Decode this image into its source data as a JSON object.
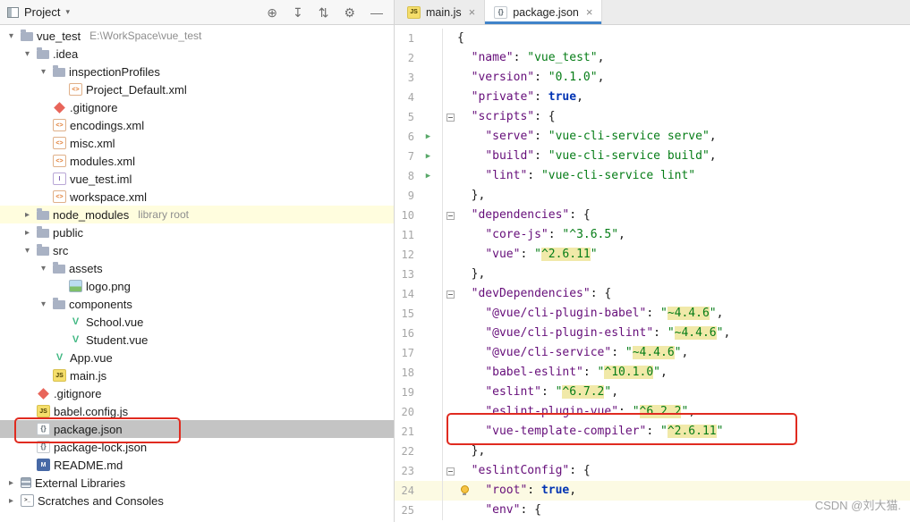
{
  "colors": {
    "accent_blue": "#4083C9",
    "selection_gray": "#C4C4C4",
    "row_yellow": "#FFFDDE",
    "caret_line": "#FCFAE3",
    "match_yellow": "#F1E9A9",
    "red_box": "#E02B20",
    "key_purple": "#660E7A",
    "string_green": "#067D17",
    "keyword_blue": "#0033B3",
    "run_green": "#59A869"
  },
  "toolbar": {
    "project_label": "Project",
    "dropdown_glyph": "▾",
    "icons": [
      {
        "name": "locate-file-icon",
        "glyph": "⊕"
      },
      {
        "name": "scroll-to-source-icon",
        "glyph": "↧"
      },
      {
        "name": "collapse-all-icon",
        "glyph": "⇅"
      },
      {
        "name": "settings-gear-icon",
        "glyph": "⚙"
      },
      {
        "name": "hide-panel-icon",
        "glyph": "—"
      }
    ]
  },
  "tabs": [
    {
      "label": "main.js",
      "icon": "js",
      "close_glyph": "×",
      "active": false
    },
    {
      "label": "package.json",
      "icon": "json",
      "close_glyph": "×",
      "active": true
    }
  ],
  "tree": [
    {
      "indent": 0,
      "chevron": "down",
      "icon": "folder",
      "label": "vue_test",
      "suffix": "E:\\WorkSpace\\vue_test"
    },
    {
      "indent": 1,
      "chevron": "down",
      "icon": "folder",
      "label": ".idea"
    },
    {
      "indent": 2,
      "chevron": "down",
      "icon": "folder",
      "label": "inspectionProfiles"
    },
    {
      "indent": 3,
      "chevron": null,
      "icon": "xml",
      "label": "Project_Default.xml"
    },
    {
      "indent": 2,
      "chevron": null,
      "icon": "gitignore",
      "label": ".gitignore"
    },
    {
      "indent": 2,
      "chevron": null,
      "icon": "xml",
      "label": "encodings.xml"
    },
    {
      "indent": 2,
      "chevron": null,
      "icon": "xml",
      "label": "misc.xml"
    },
    {
      "indent": 2,
      "chevron": null,
      "icon": "xml",
      "label": "modules.xml"
    },
    {
      "indent": 2,
      "chevron": null,
      "icon": "iml",
      "label": "vue_test.iml"
    },
    {
      "indent": 2,
      "chevron": null,
      "icon": "xml",
      "label": "workspace.xml"
    },
    {
      "indent": 1,
      "chevron": "right",
      "icon": "folder",
      "label": "node_modules",
      "suffix": "library root",
      "highlight": true
    },
    {
      "indent": 1,
      "chevron": "right",
      "icon": "folder",
      "label": "public"
    },
    {
      "indent": 1,
      "chevron": "down",
      "icon": "folder",
      "label": "src"
    },
    {
      "indent": 2,
      "chevron": "down",
      "icon": "folder",
      "label": "assets"
    },
    {
      "indent": 3,
      "chevron": null,
      "icon": "image",
      "label": "logo.png"
    },
    {
      "indent": 2,
      "chevron": "down",
      "icon": "folder",
      "label": "components"
    },
    {
      "indent": 3,
      "chevron": null,
      "icon": "vue",
      "label": "School.vue"
    },
    {
      "indent": 3,
      "chevron": null,
      "icon": "vue",
      "label": "Student.vue"
    },
    {
      "indent": 2,
      "chevron": null,
      "icon": "vue",
      "label": "App.vue"
    },
    {
      "indent": 2,
      "chevron": null,
      "icon": "js",
      "label": "main.js"
    },
    {
      "indent": 1,
      "chevron": null,
      "icon": "gitignore",
      "label": ".gitignore"
    },
    {
      "indent": 1,
      "chevron": null,
      "icon": "js",
      "label": "babel.config.js"
    },
    {
      "indent": 1,
      "chevron": null,
      "icon": "json",
      "label": "package.json",
      "selected": true
    },
    {
      "indent": 1,
      "chevron": null,
      "icon": "json",
      "label": "package-lock.json"
    },
    {
      "indent": 1,
      "chevron": null,
      "icon": "md",
      "label": "README.md"
    },
    {
      "indent": 0,
      "chevron": "right",
      "icon": "lib",
      "label": "External Libraries"
    },
    {
      "indent": 0,
      "chevron": "right",
      "icon": "console",
      "label": "Scratches and Consoles"
    }
  ],
  "editor": {
    "lines": [
      {
        "n": 1,
        "segs": [
          [
            "{",
            "p"
          ]
        ]
      },
      {
        "n": 2,
        "segs": [
          [
            "  ",
            "p"
          ],
          [
            "\"name\"",
            "k"
          ],
          [
            ": ",
            "p"
          ],
          [
            "\"vue_test\"",
            "s"
          ],
          [
            ",",
            "p"
          ]
        ]
      },
      {
        "n": 3,
        "segs": [
          [
            "  ",
            "p"
          ],
          [
            "\"version\"",
            "k"
          ],
          [
            ": ",
            "p"
          ],
          [
            "\"0.1.0\"",
            "s"
          ],
          [
            ",",
            "p"
          ]
        ]
      },
      {
        "n": 4,
        "segs": [
          [
            "  ",
            "p"
          ],
          [
            "\"private\"",
            "k"
          ],
          [
            ": ",
            "p"
          ],
          [
            "true",
            "b"
          ],
          [
            ",",
            "p"
          ]
        ]
      },
      {
        "n": 5,
        "fold": true,
        "segs": [
          [
            "  ",
            "p"
          ],
          [
            "\"scripts\"",
            "k"
          ],
          [
            ": {",
            "p"
          ]
        ]
      },
      {
        "n": 6,
        "run": true,
        "segs": [
          [
            "    ",
            "p"
          ],
          [
            "\"serve\"",
            "k"
          ],
          [
            ": ",
            "p"
          ],
          [
            "\"vue-cli-service serve\"",
            "s"
          ],
          [
            ",",
            "p"
          ]
        ]
      },
      {
        "n": 7,
        "run": true,
        "segs": [
          [
            "    ",
            "p"
          ],
          [
            "\"build\"",
            "k"
          ],
          [
            ": ",
            "p"
          ],
          [
            "\"vue-cli-service build\"",
            "s"
          ],
          [
            ",",
            "p"
          ]
        ]
      },
      {
        "n": 8,
        "run": true,
        "segs": [
          [
            "    ",
            "p"
          ],
          [
            "\"lint\"",
            "k"
          ],
          [
            ": ",
            "p"
          ],
          [
            "\"vue-cli-service lint\"",
            "s"
          ]
        ]
      },
      {
        "n": 9,
        "segs": [
          [
            "  },",
            "p"
          ]
        ]
      },
      {
        "n": 10,
        "fold": true,
        "segs": [
          [
            "  ",
            "p"
          ],
          [
            "\"dependencies\"",
            "k"
          ],
          [
            ": {",
            "p"
          ]
        ]
      },
      {
        "n": 11,
        "segs": [
          [
            "    ",
            "p"
          ],
          [
            "\"core-js\"",
            "k"
          ],
          [
            ": ",
            "p"
          ],
          [
            "\"^3.6.5\"",
            "s"
          ],
          [
            ",",
            "p"
          ]
        ]
      },
      {
        "n": 12,
        "segs": [
          [
            "    ",
            "p"
          ],
          [
            "\"vue\"",
            "k"
          ],
          [
            ": ",
            "p"
          ],
          [
            "\"",
            "s"
          ],
          [
            "^2.6.11",
            "h"
          ],
          [
            "\"",
            "s"
          ]
        ]
      },
      {
        "n": 13,
        "segs": [
          [
            "  },",
            "p"
          ]
        ]
      },
      {
        "n": 14,
        "fold": true,
        "segs": [
          [
            "  ",
            "p"
          ],
          [
            "\"devDependencies\"",
            "k"
          ],
          [
            ": {",
            "p"
          ]
        ]
      },
      {
        "n": 15,
        "segs": [
          [
            "    ",
            "p"
          ],
          [
            "\"@vue/cli-plugin-babel\"",
            "k"
          ],
          [
            ": ",
            "p"
          ],
          [
            "\"",
            "s"
          ],
          [
            "~4.4.6",
            "h"
          ],
          [
            "\"",
            "s"
          ],
          [
            ",",
            "p"
          ]
        ]
      },
      {
        "n": 16,
        "segs": [
          [
            "    ",
            "p"
          ],
          [
            "\"@vue/cli-plugin-eslint\"",
            "k"
          ],
          [
            ": ",
            "p"
          ],
          [
            "\"",
            "s"
          ],
          [
            "~4.4.6",
            "h"
          ],
          [
            "\"",
            "s"
          ],
          [
            ",",
            "p"
          ]
        ]
      },
      {
        "n": 17,
        "segs": [
          [
            "    ",
            "p"
          ],
          [
            "\"@vue/cli-service\"",
            "k"
          ],
          [
            ": ",
            "p"
          ],
          [
            "\"",
            "s"
          ],
          [
            "~4.4.6",
            "h"
          ],
          [
            "\"",
            "s"
          ],
          [
            ",",
            "p"
          ]
        ]
      },
      {
        "n": 18,
        "segs": [
          [
            "    ",
            "p"
          ],
          [
            "\"babel-eslint\"",
            "k"
          ],
          [
            ": ",
            "p"
          ],
          [
            "\"",
            "s"
          ],
          [
            "^10.1.0",
            "h"
          ],
          [
            "\"",
            "s"
          ],
          [
            ",",
            "p"
          ]
        ]
      },
      {
        "n": 19,
        "segs": [
          [
            "    ",
            "p"
          ],
          [
            "\"eslint\"",
            "k"
          ],
          [
            ": ",
            "p"
          ],
          [
            "\"",
            "s"
          ],
          [
            "^6.7.2",
            "h"
          ],
          [
            "\"",
            "s"
          ],
          [
            ",",
            "p"
          ]
        ]
      },
      {
        "n": 20,
        "segs": [
          [
            "    ",
            "p"
          ],
          [
            "\"eslint-plugin-vue\"",
            "k"
          ],
          [
            ": ",
            "p"
          ],
          [
            "\"",
            "s"
          ],
          [
            "^6.2.2",
            "h"
          ],
          [
            "\"",
            "s"
          ],
          [
            ",",
            "p"
          ]
        ]
      },
      {
        "n": 21,
        "segs": [
          [
            "    ",
            "p"
          ],
          [
            "\"vue-template-compiler\"",
            "k"
          ],
          [
            ": ",
            "p"
          ],
          [
            "\"",
            "s"
          ],
          [
            "^2.6.11",
            "h"
          ],
          [
            "\"",
            "s"
          ]
        ]
      },
      {
        "n": 22,
        "segs": [
          [
            "  },",
            "p"
          ]
        ]
      },
      {
        "n": 23,
        "fold": true,
        "segs": [
          [
            "  ",
            "p"
          ],
          [
            "\"eslintConfig\"",
            "k"
          ],
          [
            ": {",
            "p"
          ]
        ]
      },
      {
        "n": 24,
        "caret": true,
        "bulb": true,
        "segs": [
          [
            "    ",
            "p"
          ],
          [
            "\"root\"",
            "k"
          ],
          [
            ": ",
            "p"
          ],
          [
            "true",
            "b"
          ],
          [
            ",",
            "p"
          ]
        ]
      },
      {
        "n": 25,
        "segs": [
          [
            "    ",
            "p"
          ],
          [
            "\"env\"",
            "k"
          ],
          [
            ": {",
            "p"
          ]
        ]
      }
    ]
  },
  "watermark": "CSDN @刘大猫."
}
